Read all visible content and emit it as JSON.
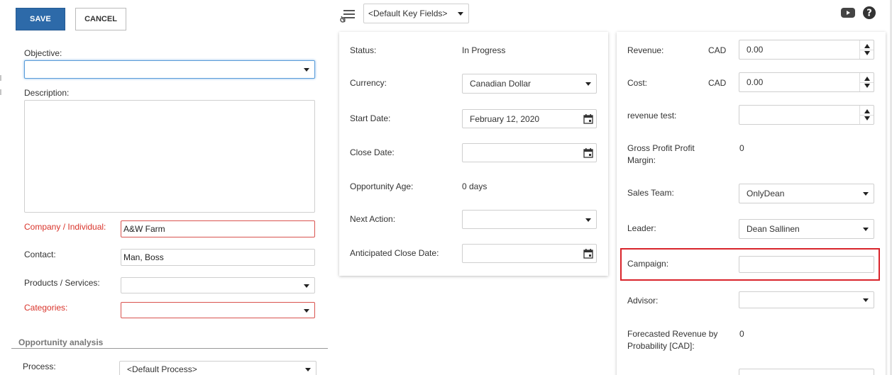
{
  "toolbar": {
    "save_label": "SAVE",
    "cancel_label": "CANCEL",
    "key_fields_select": "<Default Key Fields>"
  },
  "left": {
    "objective_label": "Objective:",
    "objective_value": "",
    "description_label": "Description:",
    "company_label": "Company / Individual:",
    "company_value": "A&W Farm",
    "contact_label": "Contact:",
    "contact_value": "Man, Boss",
    "products_label": "Products / Services:",
    "products_value": "",
    "categories_label": "Categories:",
    "categories_value": "",
    "section_title": "Opportunity analysis",
    "process_label": "Process:",
    "process_value": "<Default Process>"
  },
  "middle": {
    "status_label": "Status:",
    "status_value": "In Progress",
    "currency_label": "Currency:",
    "currency_value": "Canadian Dollar",
    "start_label": "Start Date:",
    "start_value": "February 12, 2020",
    "close_label": "Close Date:",
    "close_value": "",
    "age_label": "Opportunity Age:",
    "age_value": "0 days",
    "next_label": "Next Action:",
    "next_value": "",
    "anticipated_label": "Anticipated Close Date:",
    "anticipated_value": ""
  },
  "right": {
    "revenue_label": "Revenue:",
    "revenue_currency": "CAD",
    "revenue_value": "0.00",
    "cost_label": "Cost:",
    "cost_currency": "CAD",
    "cost_value": "0.00",
    "revtest_label": "revenue test:",
    "revtest_value": "",
    "gpm_label_1": "Gross Profit Profit",
    "gpm_label_2": "Margin:",
    "gpm_value": "0",
    "salesteam_label": "Sales Team:",
    "salesteam_value": "OnlyDean",
    "leader_label": "Leader:",
    "leader_value": "Dean Sallinen",
    "campaign_label": "Campaign:",
    "campaign_value": "",
    "advisor_label": "Advisor:",
    "advisor_value": "",
    "forecast_label_1": "Forecasted Revenue by",
    "forecast_label_2": "Probability [CAD]:",
    "forecast_value": "0"
  },
  "icons": {
    "layout": "layout-settings-icon",
    "video": "youtube-icon",
    "help": "help-icon"
  },
  "colors": {
    "primary": "#2d6aa9",
    "required": "#d9342b",
    "highlight": "#d9242b"
  }
}
